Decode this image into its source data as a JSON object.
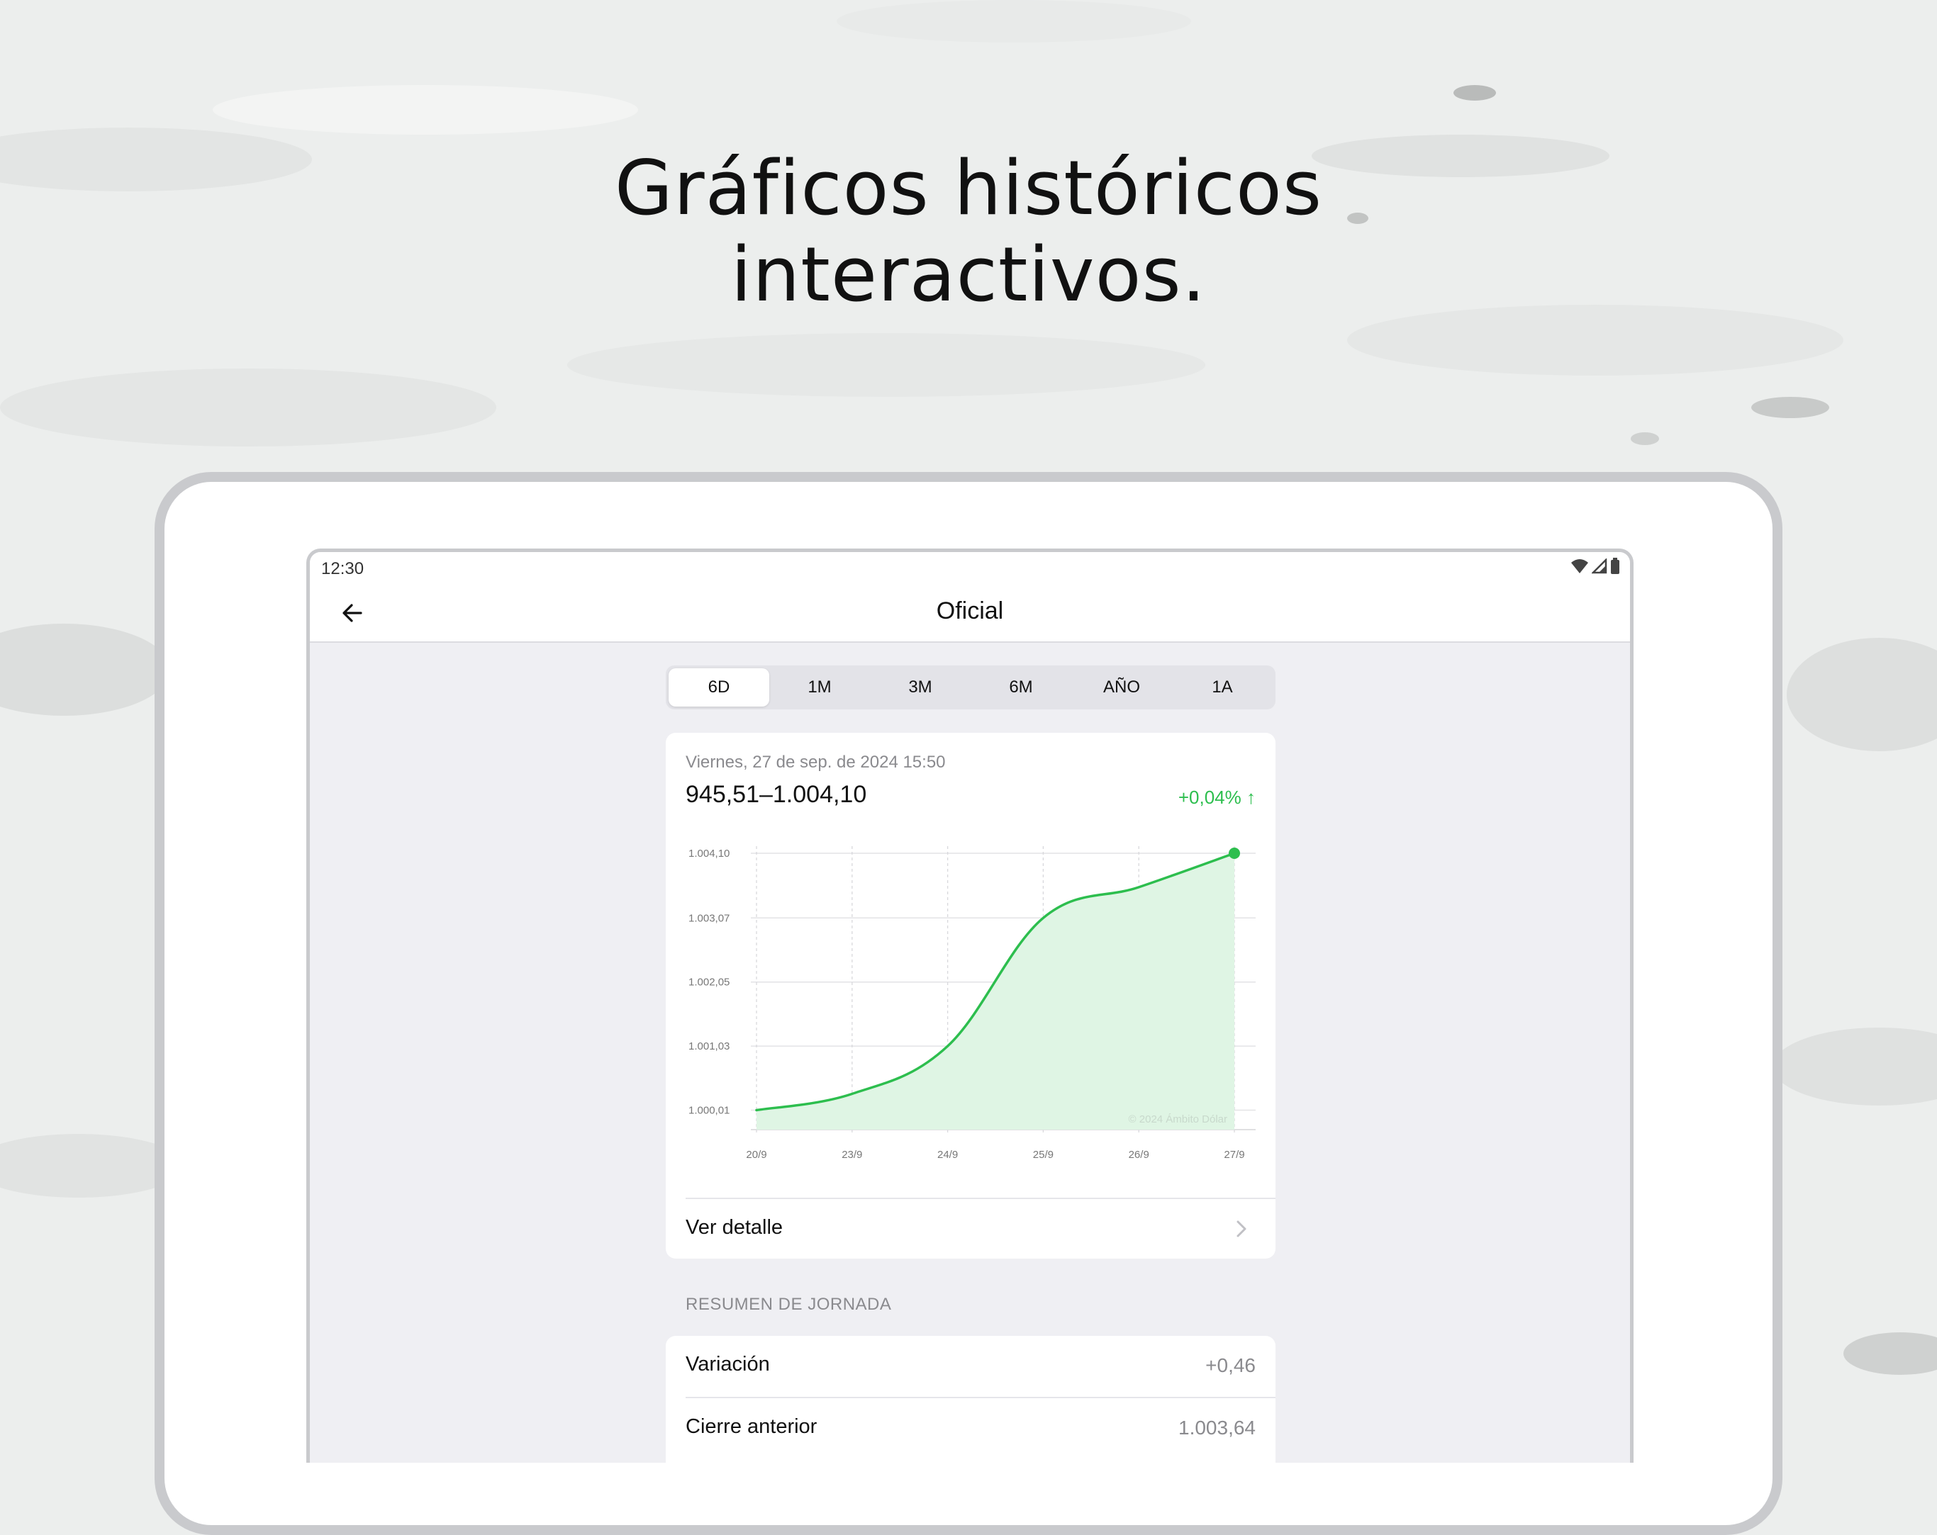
{
  "colors": {
    "accent_green": "#2dbe4e",
    "area_fill": "#dff5e4",
    "background": "#eceeed",
    "screen_bg": "#efeff3"
  },
  "headline": {
    "line1": "Gráficos históricos",
    "line2": "interactivos."
  },
  "status_bar": {
    "time": "12:30",
    "icons": [
      "wifi-icon",
      "signal-icon",
      "battery-icon"
    ]
  },
  "nav": {
    "back_icon": "arrow-left-icon",
    "title": "Oficial"
  },
  "range_tabs": [
    {
      "label": "6D",
      "selected": true
    },
    {
      "label": "1M",
      "selected": false
    },
    {
      "label": "3M",
      "selected": false
    },
    {
      "label": "6M",
      "selected": false
    },
    {
      "label": "AÑO",
      "selected": false
    },
    {
      "label": "1A",
      "selected": false
    }
  ],
  "card": {
    "date": "Viernes, 27 de sep. de 2024 15:50",
    "range": "945,51–1.004,10",
    "change": "+0,04% ↑",
    "detail_label": "Ver detalle",
    "detail_icon": "chevron-right-icon"
  },
  "chart_data": {
    "type": "area",
    "x": [
      "20/9",
      "23/9",
      "24/9",
      "25/9",
      "26/9",
      "27/9"
    ],
    "y_ticks": [
      "1.004,10",
      "1.003,07",
      "1.002,05",
      "1.001,03",
      "1.000,01"
    ],
    "y_tick_values": [
      1004.1,
      1003.07,
      1002.05,
      1001.03,
      1000.01
    ],
    "series": [
      {
        "values": [
          1000.01,
          1000.27,
          1001.03,
          1003.07,
          1003.56,
          1004.1
        ]
      }
    ],
    "ylim": [
      999.7,
      1004.1
    ],
    "watermark": "© 2024 Ámbito Dólar",
    "grid": true
  },
  "summary": {
    "section_title": "RESUMEN DE JORNADA",
    "rows": [
      {
        "label": "Variación",
        "value": "+0,46"
      },
      {
        "label": "Cierre anterior",
        "value": "1.003,64"
      }
    ]
  }
}
